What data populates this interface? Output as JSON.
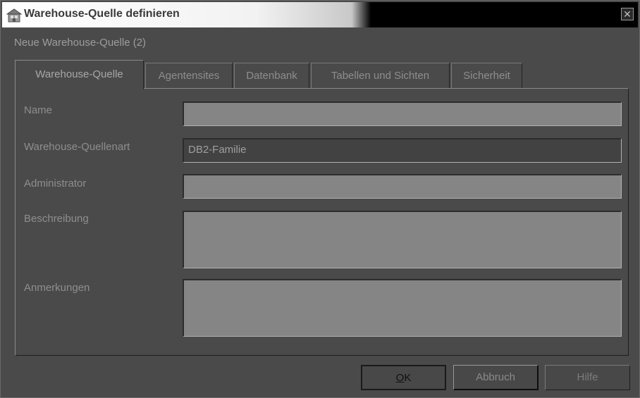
{
  "window": {
    "title": "Warehouse-Quelle definieren",
    "close_label": "✕"
  },
  "subtitle": "Neue Warehouse-Quelle (2)",
  "tabs": [
    {
      "label": "Warehouse-Quelle",
      "active": true
    },
    {
      "label": "Agentensites",
      "active": false
    },
    {
      "label": "Datenbank",
      "active": false
    },
    {
      "label": "Tabellen und Sichten",
      "active": false
    },
    {
      "label": "Sicherheit",
      "active": false
    }
  ],
  "form": {
    "name_label": "Name",
    "name_value": "",
    "type_label": "Warehouse-Quellenart",
    "type_value": "DB2-Familie",
    "admin_label": "Administrator",
    "admin_value": "",
    "description_label": "Beschreibung",
    "description_value": "",
    "notes_label": "Anmerkungen",
    "notes_value": ""
  },
  "buttons": {
    "ok_mnemonic": "O",
    "ok_rest": "K",
    "cancel": "Abbruch",
    "help": "Hilfe"
  }
}
